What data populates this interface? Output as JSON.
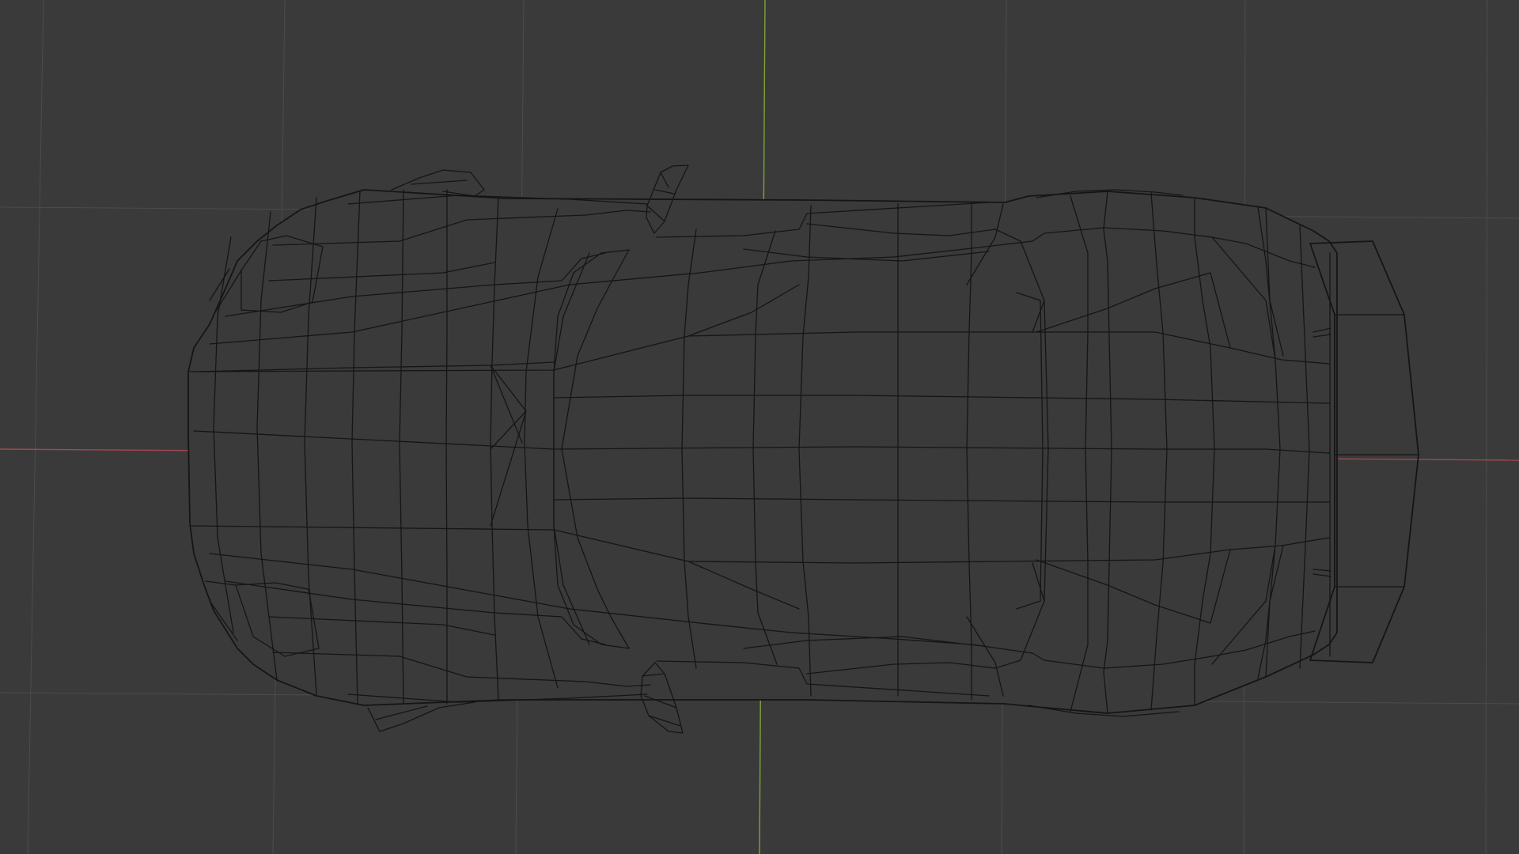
{
  "viewport": {
    "background": "#3a3a3a",
    "grid_color": "#4c4c4c",
    "x_axis_color": "#a3484f",
    "y_axis_color": "#7ea33a",
    "wire_color": "#151515",
    "view": "top-orthographic",
    "object": "car-mesh-wireframe"
  }
}
